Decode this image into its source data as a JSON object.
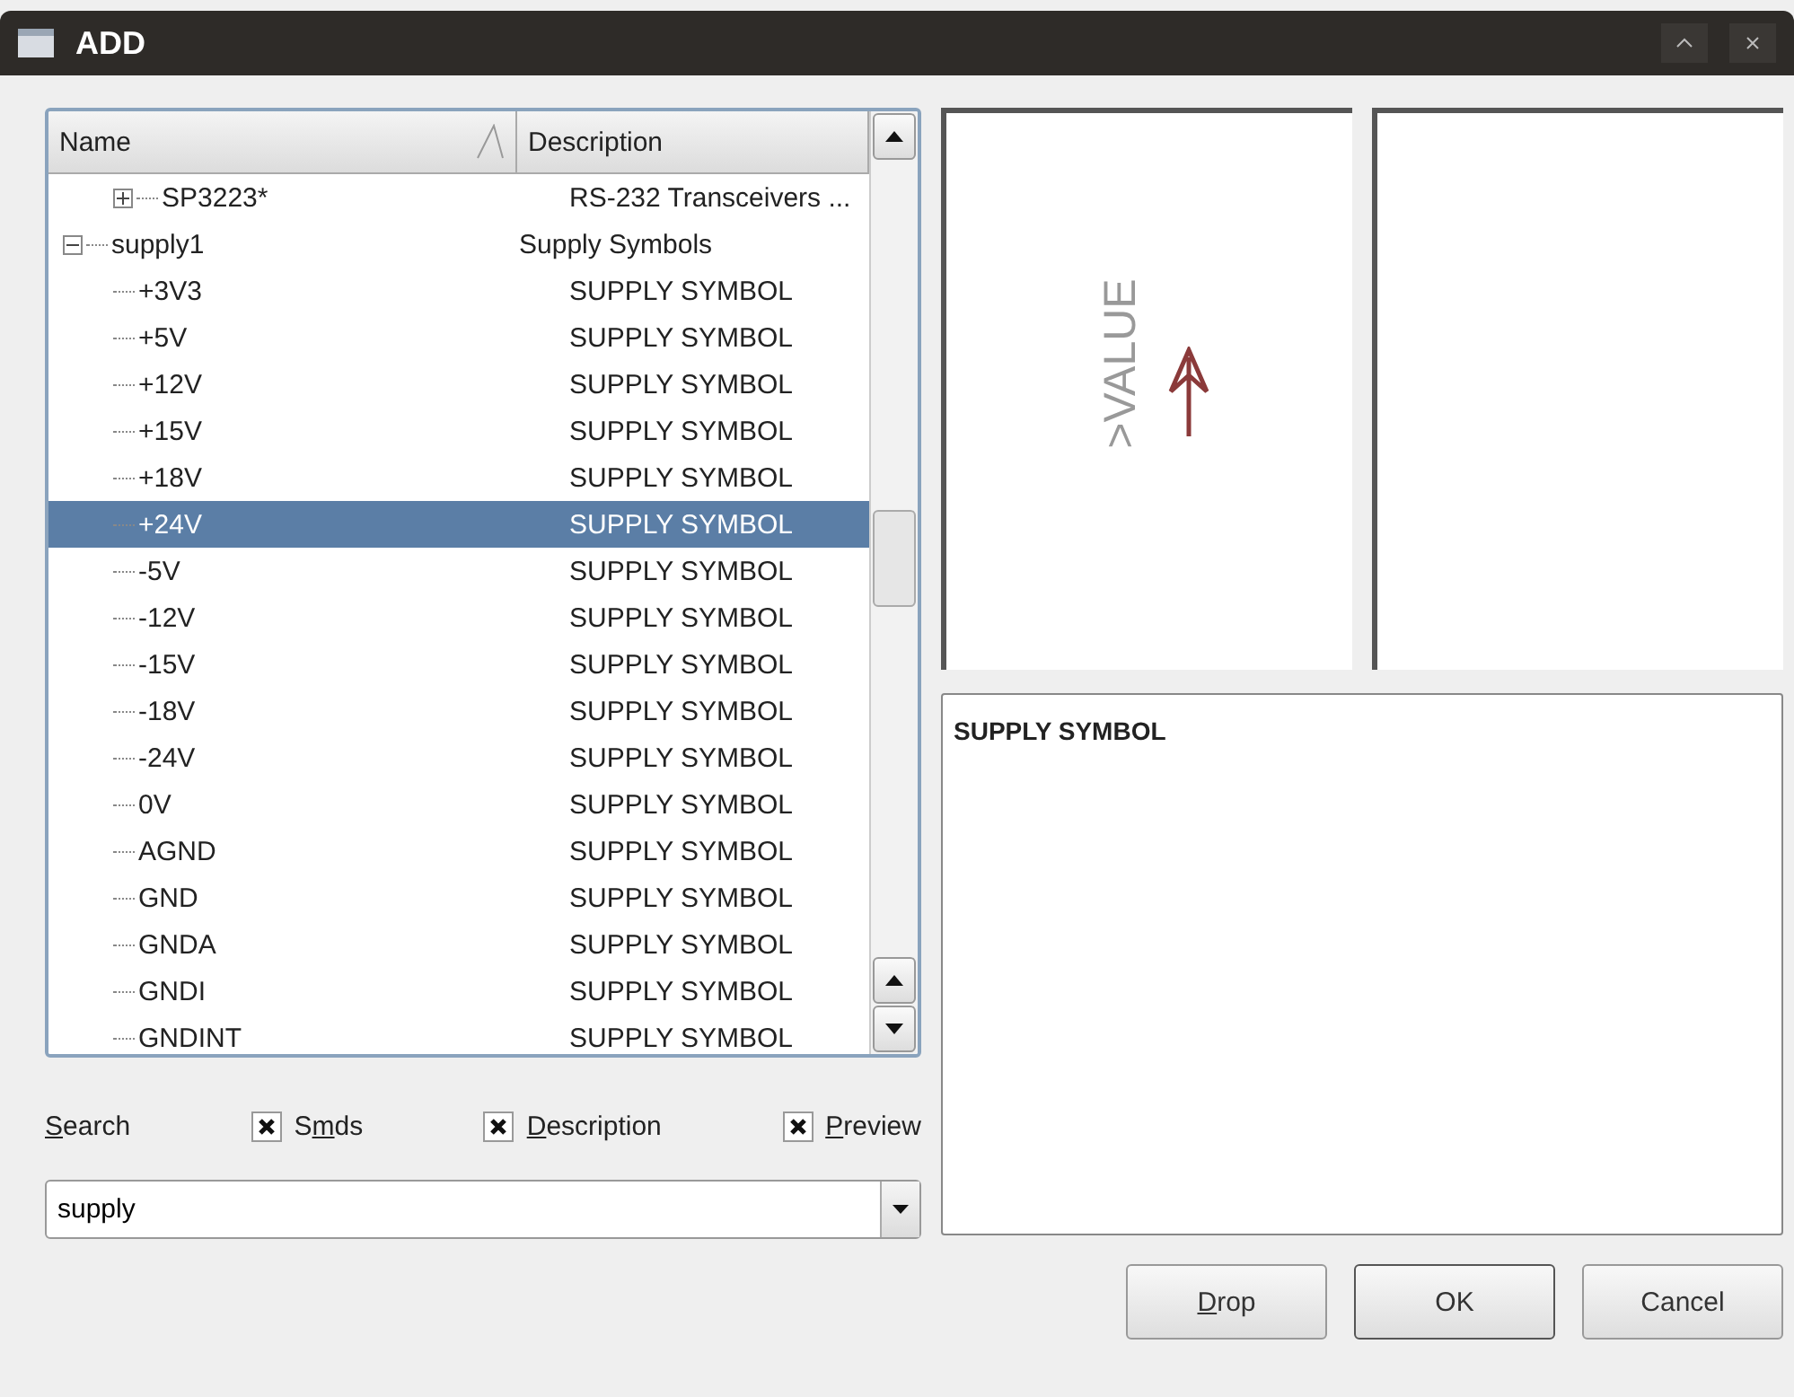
{
  "window": {
    "title": "ADD"
  },
  "tree": {
    "columns": [
      "Name",
      "Description"
    ],
    "rows": [
      {
        "children": [
          {
            "name": "SP3223*",
            "description": "RS-232 Transceivers ...",
            "expanded": false,
            "selected": false
          }
        ]
      },
      {
        "name": "supply1",
        "description": "Supply Symbols",
        "expanded": true,
        "selected": false,
        "children": [
          {
            "name": "+3V3",
            "description": "SUPPLY SYMBOL",
            "selected": false
          },
          {
            "name": "+5V",
            "description": "SUPPLY SYMBOL",
            "selected": false
          },
          {
            "name": "+12V",
            "description": "SUPPLY SYMBOL",
            "selected": false
          },
          {
            "name": "+15V",
            "description": "SUPPLY SYMBOL",
            "selected": false
          },
          {
            "name": "+18V",
            "description": "SUPPLY SYMBOL",
            "selected": false
          },
          {
            "name": "+24V",
            "description": "SUPPLY SYMBOL",
            "selected": true
          },
          {
            "name": "-5V",
            "description": "SUPPLY SYMBOL",
            "selected": false
          },
          {
            "name": "-12V",
            "description": "SUPPLY SYMBOL",
            "selected": false
          },
          {
            "name": "-15V",
            "description": "SUPPLY SYMBOL",
            "selected": false
          },
          {
            "name": "-18V",
            "description": "SUPPLY SYMBOL",
            "selected": false
          },
          {
            "name": "-24V",
            "description": "SUPPLY SYMBOL",
            "selected": false
          },
          {
            "name": "0V",
            "description": "SUPPLY SYMBOL",
            "selected": false
          },
          {
            "name": "AGND",
            "description": "SUPPLY SYMBOL",
            "selected": false
          },
          {
            "name": "GND",
            "description": "SUPPLY SYMBOL",
            "selected": false
          },
          {
            "name": "GNDA",
            "description": "SUPPLY SYMBOL",
            "selected": false
          },
          {
            "name": "GNDI",
            "description": "SUPPLY SYMBOL",
            "selected": false
          },
          {
            "name": "GNDINT",
            "description": "SUPPLY SYMBOL",
            "selected": false
          }
        ]
      }
    ]
  },
  "search": {
    "label_parts": [
      {
        "text": "S",
        "underlined": true
      },
      {
        "text": "earch",
        "underlined": false
      }
    ],
    "options": [
      {
        "label_parts": [
          {
            "text": "S",
            "underlined": false
          },
          {
            "text": "m",
            "underlined": true
          },
          {
            "text": "ds",
            "underlined": false
          }
        ],
        "checked": true
      },
      {
        "label_parts": [
          {
            "text": "D",
            "underlined": true
          },
          {
            "text": "escription",
            "underlined": false
          }
        ],
        "checked": true
      },
      {
        "label_parts": [
          {
            "text": "P",
            "underlined": true
          },
          {
            "text": "review",
            "underlined": false
          }
        ],
        "checked": true
      }
    ],
    "value": "supply"
  },
  "preview": {
    "symbol_text": ">VALUE"
  },
  "description": "SUPPLY SYMBOL",
  "buttons": [
    {
      "label_parts": [
        {
          "text": "D",
          "underlined": true
        },
        {
          "text": "rop",
          "underlined": false
        }
      ],
      "default": false
    },
    {
      "label_parts": [
        {
          "text": "OK",
          "underlined": false
        }
      ],
      "default": true
    },
    {
      "label_parts": [
        {
          "text": "Cancel",
          "underlined": false
        }
      ],
      "default": false
    }
  ]
}
